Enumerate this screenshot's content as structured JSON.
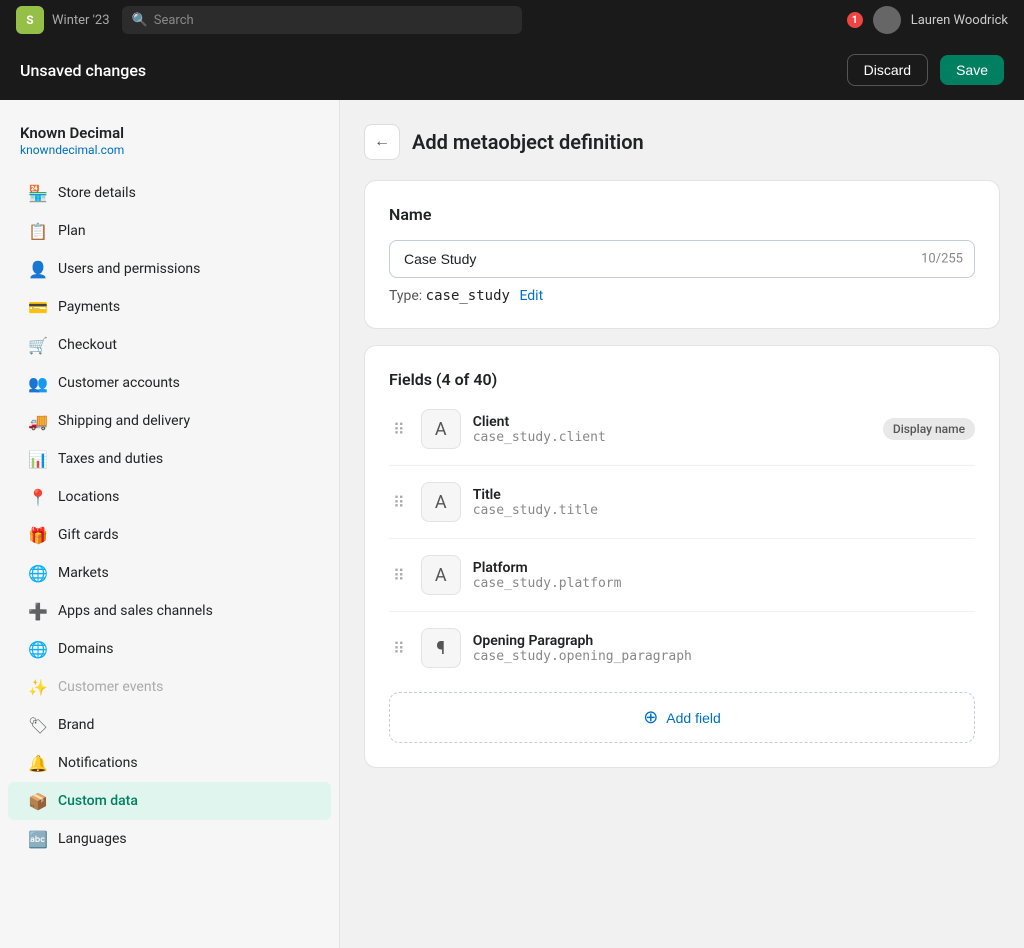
{
  "browser": {
    "logo": "S",
    "store_label": "Winter '23",
    "search_placeholder": "Search",
    "notification_count": "1",
    "user_name": "Lauren Woodrick"
  },
  "unsaved_bar": {
    "title": "Unsaved changes",
    "discard_label": "Discard",
    "save_label": "Save"
  },
  "sidebar": {
    "brand_name": "Known Decimal",
    "brand_url": "knowndecimal.com",
    "items": [
      {
        "id": "store-details",
        "label": "Store details",
        "icon": "🏪"
      },
      {
        "id": "plan",
        "label": "Plan",
        "icon": "📋"
      },
      {
        "id": "users-permissions",
        "label": "Users and permissions",
        "icon": "👤"
      },
      {
        "id": "payments",
        "label": "Payments",
        "icon": "💳"
      },
      {
        "id": "checkout",
        "label": "Checkout",
        "icon": "🛒"
      },
      {
        "id": "customer-accounts",
        "label": "Customer accounts",
        "icon": "👥"
      },
      {
        "id": "shipping-delivery",
        "label": "Shipping and delivery",
        "icon": "🚚"
      },
      {
        "id": "taxes-duties",
        "label": "Taxes and duties",
        "icon": "📊"
      },
      {
        "id": "locations",
        "label": "Locations",
        "icon": "📍"
      },
      {
        "id": "gift-cards",
        "label": "Gift cards",
        "icon": "🎁"
      },
      {
        "id": "markets",
        "label": "Markets",
        "icon": "🌐"
      },
      {
        "id": "apps-sales",
        "label": "Apps and sales channels",
        "icon": "➕"
      },
      {
        "id": "domains",
        "label": "Domains",
        "icon": "🌐"
      },
      {
        "id": "customer-events",
        "label": "Customer events",
        "icon": "✨",
        "disabled": true
      },
      {
        "id": "brand",
        "label": "Brand",
        "icon": "🏷"
      },
      {
        "id": "notifications",
        "label": "Notifications",
        "icon": "🔔"
      },
      {
        "id": "custom-data",
        "label": "Custom data",
        "icon": "📦",
        "active": true
      },
      {
        "id": "languages",
        "label": "Languages",
        "icon": "🔤"
      }
    ]
  },
  "content": {
    "back_label": "←",
    "page_title": "Add metaobject definition",
    "name_section": {
      "title": "Name",
      "input_value": "Case Study",
      "char_count": "10/255",
      "type_label": "Type:",
      "type_value": "case_study",
      "edit_label": "Edit"
    },
    "fields_section": {
      "title": "Fields (4 of 40)",
      "fields": [
        {
          "name": "Client",
          "key": "case_study.client",
          "icon": "A",
          "icon_type": "text",
          "badge": "Display name"
        },
        {
          "name": "Title",
          "key": "case_study.title",
          "icon": "A",
          "icon_type": "text",
          "badge": null
        },
        {
          "name": "Platform",
          "key": "case_study.platform",
          "icon": "A",
          "icon_type": "text",
          "badge": null
        },
        {
          "name": "Opening Paragraph",
          "key": "case_study.opening_paragraph",
          "icon": "¶",
          "icon_type": "paragraph",
          "badge": null
        }
      ],
      "add_field_label": "Add field"
    }
  }
}
